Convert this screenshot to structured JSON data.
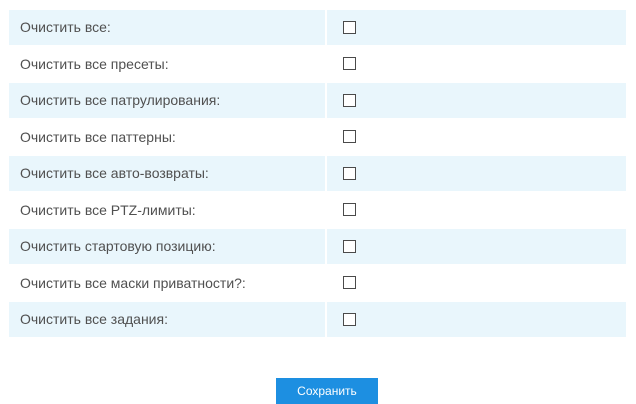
{
  "form": {
    "rows": [
      {
        "label": "Очистить все:",
        "checked": false
      },
      {
        "label": "Очистить все пресеты:",
        "checked": false
      },
      {
        "label": "Очистить все патрулирования:",
        "checked": false
      },
      {
        "label": "Очистить все паттерны:",
        "checked": false
      },
      {
        "label": "Очистить все авто-возвраты:",
        "checked": false
      },
      {
        "label": "Очистить все PTZ-лимиты:",
        "checked": false
      },
      {
        "label": "Очистить стартовую позицию:",
        "checked": false
      },
      {
        "label": "Очистить все маски приватности?:",
        "checked": false
      },
      {
        "label": "Очистить все задания:",
        "checked": false
      }
    ],
    "save_label": "Сохранить"
  },
  "colors": {
    "row_stripe": "#e9f6fc",
    "label_text": "#505050",
    "button_bg": "#1d8fe1",
    "button_text": "#ffffff"
  }
}
